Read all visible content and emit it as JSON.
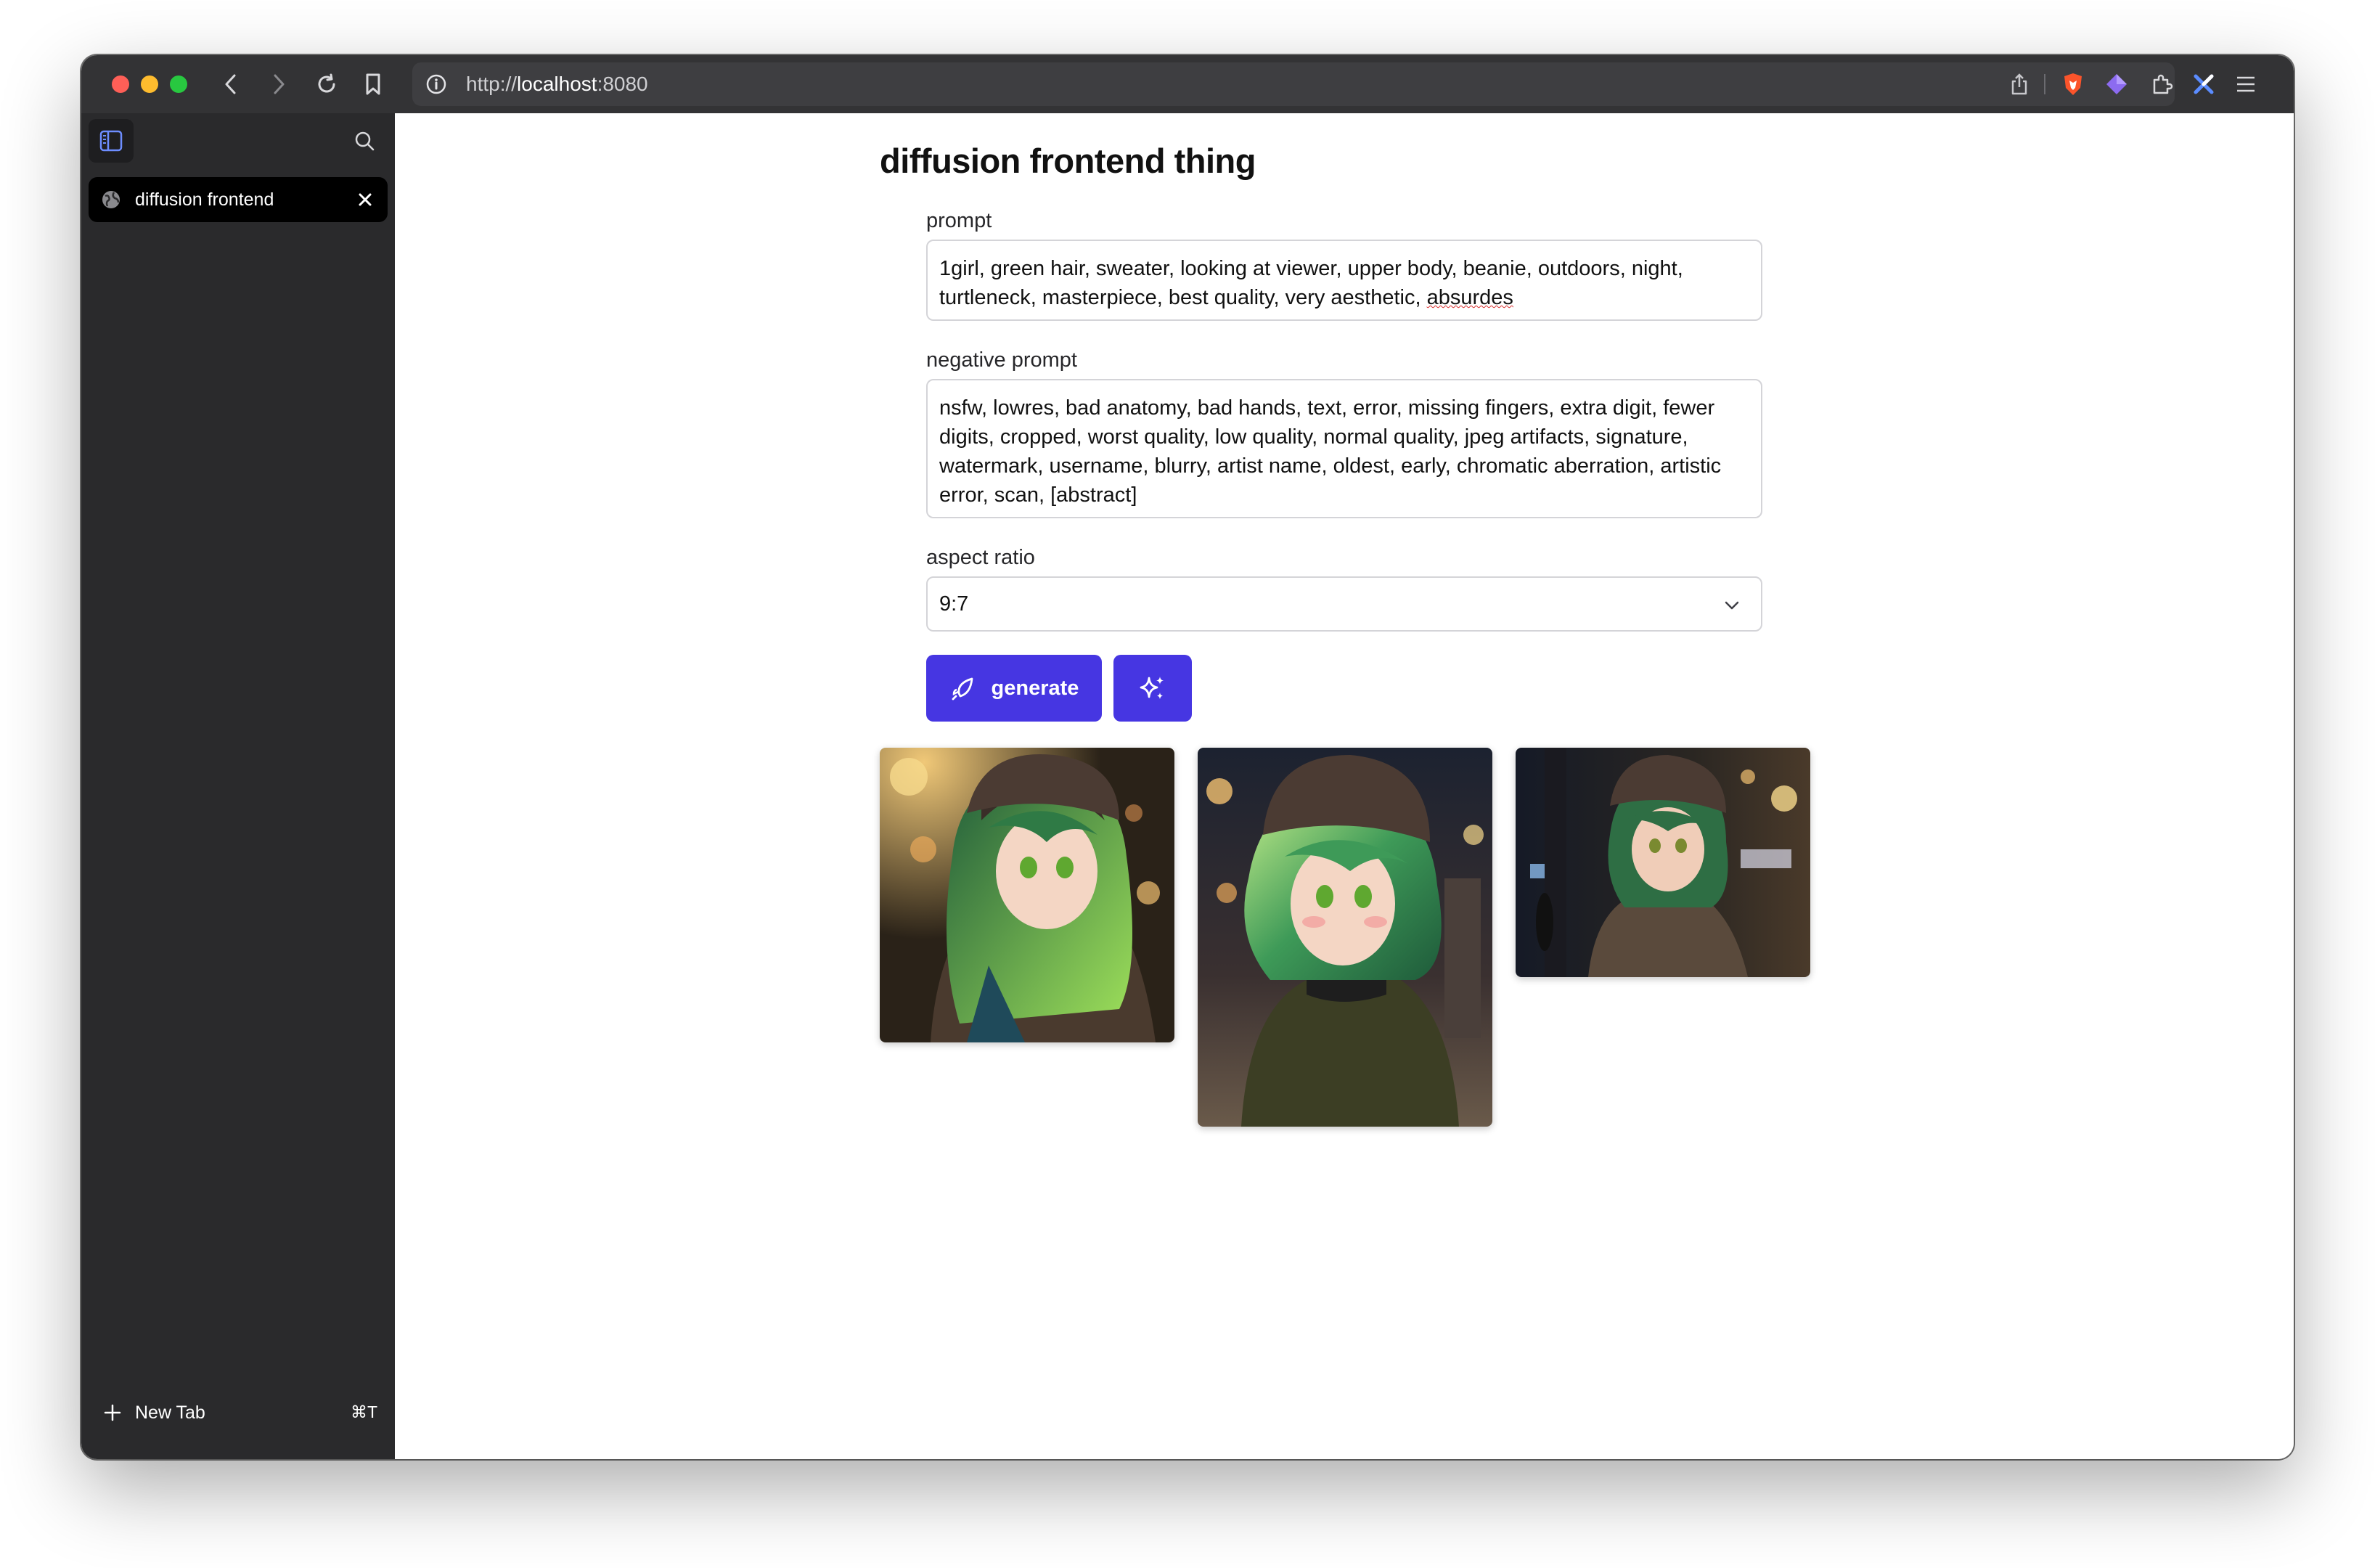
{
  "browser": {
    "url_scheme": "http://",
    "url_host": "localhost",
    "url_port": ":8080",
    "icons": [
      "back-icon",
      "forward-icon",
      "reload-icon",
      "bookmark-icon",
      "site-info-icon",
      "share-icon",
      "brave-shield-icon",
      "extension-icon",
      "puzzle-icon",
      "extension-x-icon",
      "menu-icon"
    ]
  },
  "sidebar": {
    "tab_label": "diffusion frontend",
    "new_tab_label": "New Tab",
    "new_tab_shortcut": "⌘T"
  },
  "page": {
    "title": "diffusion frontend thing",
    "prompt_label": "prompt",
    "prompt_value_main": "1girl, green hair, sweater, looking at viewer, upper body, beanie, outdoors, night, turtleneck, masterpiece, best quality, very aesthetic, ",
    "prompt_value_flagged": "absurdes",
    "negative_label": "negative prompt",
    "negative_value": "nsfw, lowres, bad anatomy, bad hands, text, error, missing fingers, extra digit, fewer digits, cropped, worst quality, low quality, normal quality, jpeg artifacts, signature, watermark, username, blurry, artist name, oldest, early, chromatic aberration, artistic error, scan, [abstract]",
    "aspect_label": "aspect ratio",
    "aspect_value": "9:7",
    "generate_label": "generate"
  },
  "colors": {
    "accent": "#4636e2",
    "topbar": "#333335",
    "sidebar": "#2a2a2c"
  }
}
